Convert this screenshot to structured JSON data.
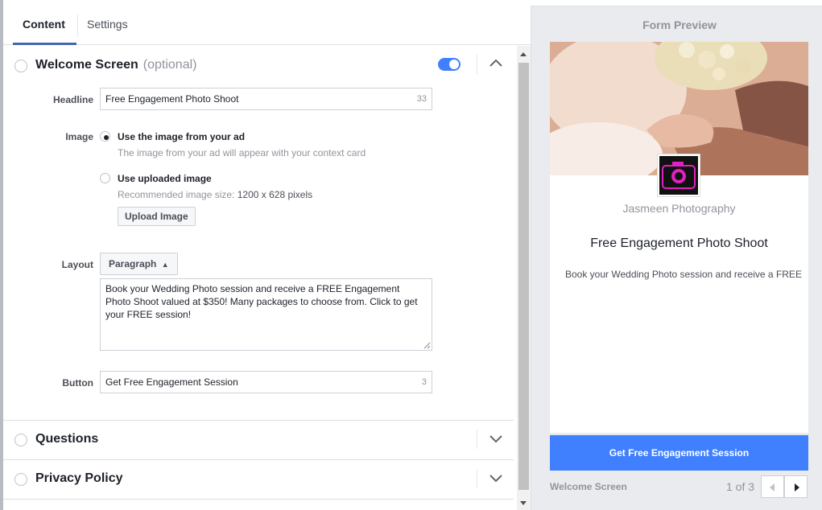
{
  "tabs": [
    {
      "label": "Content",
      "active": true
    },
    {
      "label": "Settings",
      "active": false
    }
  ],
  "welcome": {
    "title": "Welcome Screen",
    "optional": "(optional)",
    "enabled": true,
    "headline_label": "Headline",
    "headline_value": "Free Engagement Photo Shoot",
    "headline_count": "33",
    "image_label": "Image",
    "image_opt1_title": "Use the image from your ad",
    "image_opt1_sub": "The image from your ad will appear with your context card",
    "image_opt2_title": "Use uploaded image",
    "image_opt2_sub_prefix": "Recommended image size:",
    "image_opt2_sub_size": "1200 x 628 pixels",
    "upload_label": "Upload Image",
    "layout_label": "Layout",
    "layout_value": "Paragraph",
    "paragraph": "Book your Wedding Photo session and receive a FREE Engagement Photo Shoot valued at $350!  Many packages to choose from. Click to get your FREE session!",
    "button_label": "Button",
    "button_value": "Get Free Engagement Session",
    "button_count": "3"
  },
  "sections": {
    "questions": "Questions",
    "privacy": "Privacy Policy"
  },
  "preview": {
    "title": "Form Preview",
    "page_name": "Jasmeen Photography",
    "headline": "Free Engagement Photo Shoot",
    "body": "Book your Wedding Photo session and receive a FREE",
    "cta": "Get Free Engagement Session",
    "footer_label": "Welcome Screen",
    "footer_page": "1 of 3"
  },
  "colors": {
    "accent": "#4267b2",
    "cta": "#4080ff",
    "logo_magenta": "#e020c0"
  }
}
